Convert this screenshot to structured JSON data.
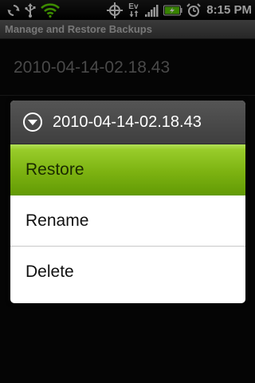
{
  "status_bar": {
    "icons_left": [
      "sync-icon",
      "usb-icon",
      "wifi-icon"
    ],
    "icons_right": [
      "gps-icon",
      "ev-data-icon",
      "signal-icon",
      "battery-icon",
      "alarm-icon"
    ],
    "ev_label": "Ev",
    "time": "8:15 PM"
  },
  "title_bar": {
    "title": "Manage and Restore Backups"
  },
  "background_list": {
    "items": [
      {
        "label": "2010-04-14-02.18.43"
      }
    ]
  },
  "dialog": {
    "title": "2010-04-14-02.18.43",
    "menu": [
      {
        "label": "Restore",
        "selected": true
      },
      {
        "label": "Rename",
        "selected": false
      },
      {
        "label": "Delete",
        "selected": false
      }
    ]
  },
  "colors": {
    "selected_green": "#7cb211",
    "dialog_header": "#474747",
    "title_bar": "#4a4a4a"
  }
}
